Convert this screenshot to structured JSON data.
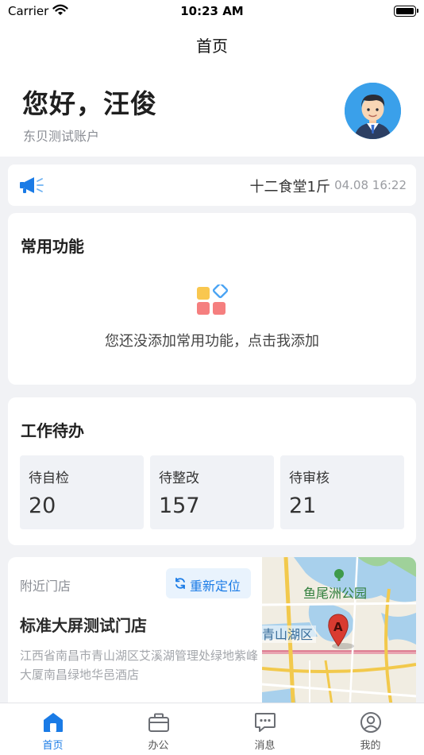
{
  "status_bar": {
    "carrier": "Carrier",
    "time": "10:23 AM"
  },
  "nav": {
    "title": "首页"
  },
  "user": {
    "greeting": "您好，汪俊",
    "account": "东贝测试账户"
  },
  "notice": {
    "text": "十二食堂1斤",
    "time": "04.08 16:22"
  },
  "quick_functions": {
    "title": "常用功能",
    "empty_text": "您还没添加常用功能，点击我添加"
  },
  "todo": {
    "title": "工作待办",
    "items": [
      {
        "label": "待自检",
        "count": "20"
      },
      {
        "label": "待整改",
        "count": "157"
      },
      {
        "label": "待审核",
        "count": "21"
      }
    ]
  },
  "store": {
    "nearby_label": "附近门店",
    "relocate_label": "重新定位",
    "name": "标准大屏测试门店",
    "address": "江西省南昌市青山湖区艾溪湖管理处绿地紫峰大厦南昌绿地华邑酒店",
    "map_labels": {
      "park": "鱼尾洲公园",
      "district": "青山湖区",
      "marker": "A"
    }
  },
  "tabs": [
    {
      "label": "首页",
      "icon": "home-icon",
      "active": true
    },
    {
      "label": "办公",
      "icon": "briefcase-icon",
      "active": false
    },
    {
      "label": "消息",
      "icon": "message-icon",
      "active": false
    },
    {
      "label": "我的",
      "icon": "profile-icon",
      "active": false
    }
  ],
  "colors": {
    "accent": "#1a7be6",
    "background": "#f1f2f5",
    "todo_item_bg": "#f0f2f6"
  }
}
